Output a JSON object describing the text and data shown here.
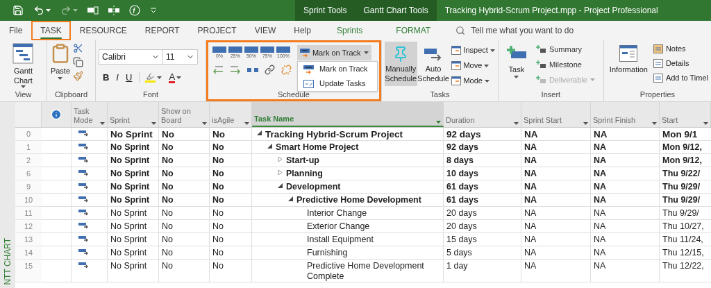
{
  "title_bar": {
    "context_tabs": [
      "Sprint Tools",
      "Gantt Chart Tools"
    ],
    "title": "Tracking Hybrid-Scrum Project.mpp  -  Project Professional"
  },
  "tabs": [
    {
      "label": "File",
      "selected": false,
      "kind": "normal"
    },
    {
      "label": "TASK",
      "selected": true,
      "kind": "normal"
    },
    {
      "label": "RESOURCE",
      "selected": false,
      "kind": "normal"
    },
    {
      "label": "REPORT",
      "selected": false,
      "kind": "normal"
    },
    {
      "label": "PROJECT",
      "selected": false,
      "kind": "normal"
    },
    {
      "label": "VIEW",
      "selected": false,
      "kind": "normal"
    },
    {
      "label": "Help",
      "selected": false,
      "kind": "normal"
    },
    {
      "label": "Sprints",
      "selected": false,
      "kind": "contextual"
    },
    {
      "label": "FORMAT",
      "selected": false,
      "kind": "contextual"
    }
  ],
  "search": {
    "placeholder": "Tell me what you want to do"
  },
  "ribbon": {
    "view": {
      "label": "View",
      "gantt_button": "Gantt Chart"
    },
    "clipboard": {
      "label": "Clipboard",
      "paste_button": "Paste"
    },
    "font": {
      "label": "Font",
      "font_name": "Calibri",
      "font_size": "11",
      "bold": "B",
      "italic": "I",
      "underline": "U",
      "font_color": "A"
    },
    "schedule": {
      "label": "Schedule",
      "highlighted": true,
      "percent_buttons": [
        "0%",
        "25%",
        "50%",
        "75%",
        "100%"
      ],
      "mark_on_track_button": "Mark on Track",
      "menu_open": true,
      "menu_items": [
        {
          "label": "Mark on Track",
          "kind": "mark"
        },
        {
          "label": "Update Tasks",
          "kind": "update"
        }
      ]
    },
    "tasks": {
      "label": "Tasks",
      "mode_buttons": [
        {
          "label": "Manually Schedule",
          "selected": true,
          "kind": "manual"
        },
        {
          "label": "Auto Schedule",
          "selected": false,
          "kind": "auto"
        }
      ],
      "small_buttons": [
        "Inspect",
        "Move",
        "Mode"
      ]
    },
    "insert": {
      "label": "Insert",
      "task_button": "Task",
      "small_buttons": [
        {
          "label": "Summary",
          "disabled": false
        },
        {
          "label": "Milestone",
          "disabled": false
        },
        {
          "label": "Deliverable",
          "disabled": true
        }
      ]
    },
    "properties": {
      "label": "Properties",
      "information_button": "Information",
      "small_buttons": [
        "Notes",
        "Details",
        "Add to Timel"
      ]
    }
  },
  "side_label": "NTT CHART",
  "table": {
    "columns": [
      {
        "label": "Task Mode",
        "selected": false
      },
      {
        "label": "Sprint",
        "selected": false
      },
      {
        "label": "Show on Board",
        "selected": false
      },
      {
        "label": "isAgile",
        "selected": false
      },
      {
        "label": "Task Name",
        "selected": true
      },
      {
        "label": "Duration",
        "selected": false
      },
      {
        "label": "Sprint Start",
        "selected": false
      },
      {
        "label": "Sprint Finish",
        "selected": false
      },
      {
        "label": "Start",
        "selected": false
      }
    ],
    "rows": [
      {
        "id": "0",
        "sprint": "No Sprint",
        "show_on_board": "No",
        "is_agile": "No",
        "name": "Tracking Hybrid-Scrum Project",
        "duration": "92 days",
        "sprint_start": "NA",
        "sprint_finish": "NA",
        "start": "Mon 9/1",
        "expanded": true,
        "children": [
          {
            "id": "1",
            "sprint": "No Sprint",
            "show_on_board": "No",
            "is_agile": "No",
            "name": "Smart Home Project",
            "duration": "92 days",
            "sprint_start": "NA",
            "sprint_finish": "NA",
            "start": "Mon 9/12,",
            "expanded": true,
            "children": [
              {
                "id": "2",
                "sprint": "No Sprint",
                "show_on_board": "No",
                "is_agile": "No",
                "name": "Start-up",
                "duration": "8 days",
                "sprint_start": "NA",
                "sprint_finish": "NA",
                "start": "Mon 9/12,",
                "expanded": false
              },
              {
                "id": "6",
                "sprint": "No Sprint",
                "show_on_board": "No",
                "is_agile": "No",
                "name": "Planning",
                "duration": "10 days",
                "sprint_start": "NA",
                "sprint_finish": "NA",
                "start": "Thu 9/22/",
                "expanded": false
              },
              {
                "id": "9",
                "sprint": "No Sprint",
                "show_on_board": "No",
                "is_agile": "No",
                "name": "Development",
                "duration": "61 days",
                "sprint_start": "NA",
                "sprint_finish": "NA",
                "start": "Thu 9/29/",
                "expanded": true,
                "children": [
                  {
                    "id": "10",
                    "sprint": "No Sprint",
                    "show_on_board": "No",
                    "is_agile": "No",
                    "name": "Predictive Home Development",
                    "duration": "61 days",
                    "sprint_start": "NA",
                    "sprint_finish": "NA",
                    "start": "Thu 9/29/",
                    "expanded": true,
                    "children": [
                      {
                        "id": "11",
                        "sprint": "No Sprint",
                        "show_on_board": "No",
                        "is_agile": "No",
                        "name": "Interior Change",
                        "duration": "20 days",
                        "sprint_start": "NA",
                        "sprint_finish": "NA",
                        "start": "Thu 9/29/"
                      },
                      {
                        "id": "12",
                        "sprint": "No Sprint",
                        "show_on_board": "No",
                        "is_agile": "No",
                        "name": "Exterior Change",
                        "duration": "20 days",
                        "sprint_start": "NA",
                        "sprint_finish": "NA",
                        "start": "Thu 10/27,"
                      },
                      {
                        "id": "13",
                        "sprint": "No Sprint",
                        "show_on_board": "No",
                        "is_agile": "No",
                        "name": "Install Equipment",
                        "duration": "15 days",
                        "sprint_start": "NA",
                        "sprint_finish": "NA",
                        "start": "Thu 11/24,"
                      },
                      {
                        "id": "14",
                        "sprint": "No Sprint",
                        "show_on_board": "No",
                        "is_agile": "No",
                        "name": "Furnishing",
                        "duration": "5 days",
                        "sprint_start": "NA",
                        "sprint_finish": "NA",
                        "start": "Thu 12/15,"
                      },
                      {
                        "id": "15",
                        "sprint": "No Sprint",
                        "show_on_board": "No",
                        "is_agile": "No",
                        "name": "Predictive Home Development Complete",
                        "duration": "1 day",
                        "sprint_start": "NA",
                        "sprint_finish": "NA",
                        "start": "Thu 12/22,"
                      }
                    ]
                  }
                ]
              }
            ]
          }
        ]
      }
    ]
  }
}
